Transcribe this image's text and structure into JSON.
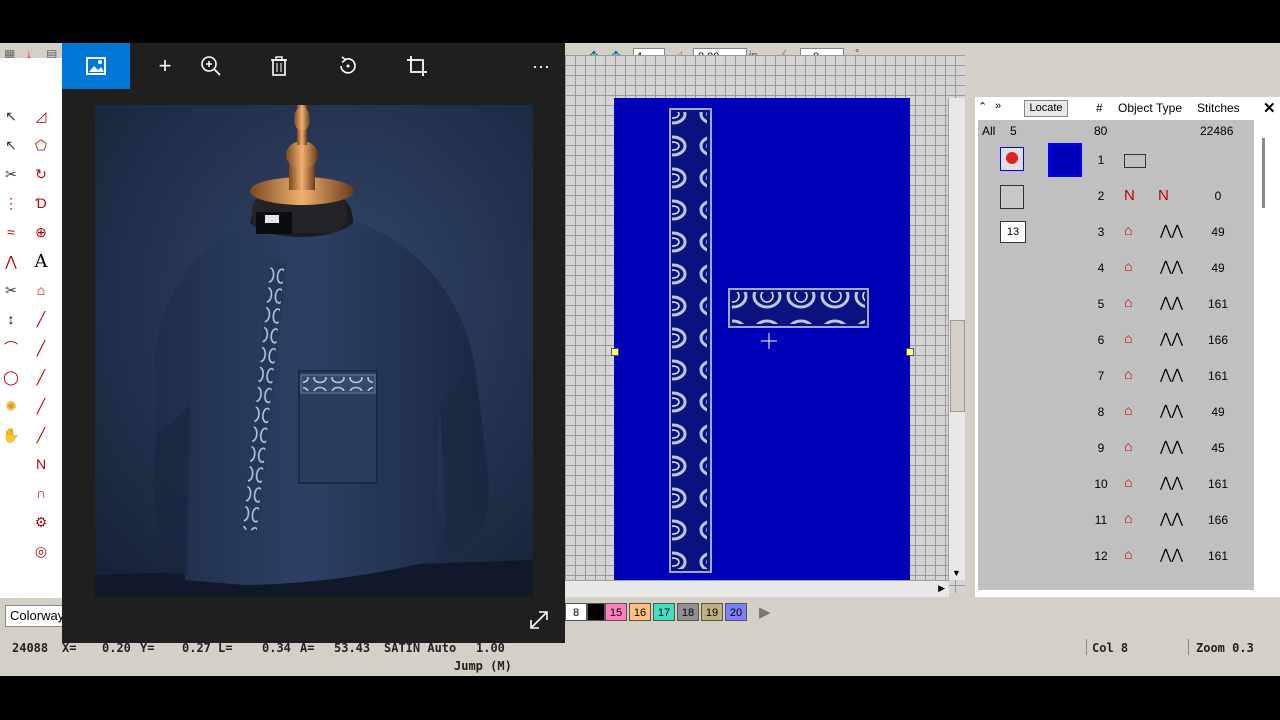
{
  "app": {
    "toolbar": {
      "field_1_value": "4",
      "field_2_value": "0.00",
      "field_2_unit": "in",
      "field_3_value": "0",
      "field_3_unit": "°"
    },
    "left_panel": {
      "colorway_label": "Colorway"
    },
    "object_list": {
      "locate_label": "Locate",
      "col_hash": "#",
      "col_object": "Object",
      "col_type": "Type",
      "col_stitches": "Stitches",
      "summary": {
        "all": "All",
        "groups": "5",
        "count": "80",
        "stitches": "22486"
      },
      "group_badge": "13",
      "rows": [
        {
          "num": "1",
          "stitches": ""
        },
        {
          "num": "2",
          "stitches": "0"
        },
        {
          "num": "3",
          "stitches": "49"
        },
        {
          "num": "4",
          "stitches": "49"
        },
        {
          "num": "5",
          "stitches": "161"
        },
        {
          "num": "6",
          "stitches": "166"
        },
        {
          "num": "7",
          "stitches": "161"
        },
        {
          "num": "8",
          "stitches": "49"
        },
        {
          "num": "9",
          "stitches": "45"
        },
        {
          "num": "10",
          "stitches": "161"
        },
        {
          "num": "11",
          "stitches": "166"
        },
        {
          "num": "12",
          "stitches": "161"
        }
      ]
    },
    "color_bar": {
      "swatches": [
        {
          "label": "8",
          "color": "#ffffff"
        },
        {
          "label": "",
          "color": "#000000"
        },
        {
          "label": "15",
          "color": "#ff80c0"
        },
        {
          "label": "16",
          "color": "#ffc080"
        },
        {
          "label": "17",
          "color": "#40e0c0"
        },
        {
          "label": "18",
          "color": "#909090"
        },
        {
          "label": "19",
          "color": "#c0b080"
        },
        {
          "label": "20",
          "color": "#8080ff"
        }
      ]
    },
    "status": {
      "stitch_count": "24088",
      "x_label": "X=",
      "x_value": "0.20",
      "y_label": "Y=",
      "y_value": "0.27",
      "l_label": "L=",
      "l_value": "0.34",
      "a_label": "A=",
      "a_value": "53.43",
      "stitch_type": "SATIN Auto",
      "density": "1.00",
      "command": "Jump (M)",
      "col": "Col 8",
      "zoom": "Zoom 0.3"
    }
  },
  "viewer": {
    "more_label": "···",
    "icons": [
      "image-icon",
      "add-icon",
      "zoom-icon",
      "delete-icon",
      "rotate-icon",
      "crop-icon",
      "more-icon",
      "expand-icon"
    ]
  },
  "colors": {
    "canvas_blue": "#0000b8",
    "garment": "#2a3b57",
    "accent_blue": "#0078d7"
  }
}
